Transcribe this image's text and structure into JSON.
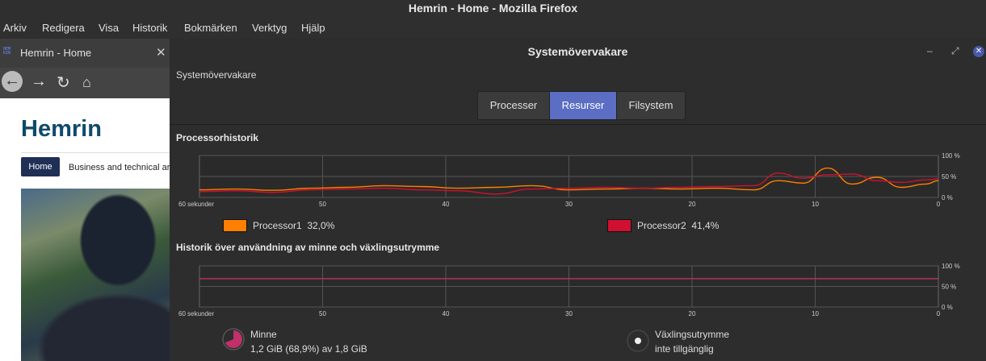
{
  "window_title": "Hemrin - Home - Mozilla Firefox",
  "menu": [
    "Arkiv",
    "Redigera",
    "Visa",
    "Historik",
    "Bokmärken",
    "Verktyg",
    "Hjälp"
  ],
  "firefox": {
    "favicon_text": "HEM RIN",
    "tab_title": "Hemrin - Home",
    "close_glyph": "✕",
    "site_title": "Hemrin",
    "nav_home": "Home",
    "nav_item2": "Business and technical ar"
  },
  "monitor": {
    "title": "Systemövervakare",
    "subtitle": "Systemövervakare",
    "tabs": [
      "Processer",
      "Resurser",
      "Filsystem"
    ],
    "active_tab": 1,
    "cpu_section": "Processorhistorik",
    "mem_section": "Historik över användning av minne och växlingsutrymme",
    "x_ticks": [
      "60 sekunder",
      "50",
      "40",
      "30",
      "20",
      "10",
      "0"
    ],
    "y_ticks": [
      "100 %",
      "50 %",
      "0 %"
    ],
    "cpu_legend": [
      {
        "name": "Processor1",
        "value": "32,0%",
        "color": "#ff7f00"
      },
      {
        "name": "Processor2",
        "value": "41,4%",
        "color": "#d01030"
      }
    ],
    "memory": {
      "label": "Minne",
      "detail": "1,2 GiB (68,9%) av 1,8 GiB",
      "fraction": 0.689,
      "color": "#c0306a"
    },
    "swap": {
      "label": "Växlingsutrymme",
      "detail": "inte tillgänglig"
    }
  },
  "chart_data": [
    {
      "type": "line",
      "title": "Processorhistorik",
      "x": [
        60,
        57,
        54,
        51,
        48,
        45,
        42,
        39,
        36,
        33,
        30,
        27,
        24,
        21,
        18,
        15,
        13,
        11,
        9,
        7,
        5,
        3,
        1,
        0
      ],
      "xlim": [
        60,
        0
      ],
      "ylim": [
        0,
        100
      ],
      "series": [
        {
          "name": "Processor1",
          "color": "#ff7f00",
          "values": [
            18,
            20,
            17,
            22,
            24,
            28,
            26,
            22,
            24,
            28,
            18,
            20,
            22,
            20,
            22,
            18,
            40,
            34,
            70,
            32,
            48,
            24,
            32,
            40
          ]
        },
        {
          "name": "Processor2",
          "color": "#d01030",
          "values": [
            14,
            16,
            12,
            18,
            20,
            22,
            18,
            16,
            8,
            20,
            22,
            24,
            22,
            24,
            26,
            28,
            58,
            46,
            54,
            56,
            40,
            36,
            42,
            44
          ]
        }
      ]
    },
    {
      "type": "line",
      "title": "Historik över användning av minne och växlingsutrymme",
      "x": [
        60,
        0
      ],
      "xlim": [
        60,
        0
      ],
      "ylim": [
        0,
        100
      ],
      "series": [
        {
          "name": "Minne",
          "color": "#c0306a",
          "values": [
            69,
            69
          ]
        }
      ]
    }
  ]
}
